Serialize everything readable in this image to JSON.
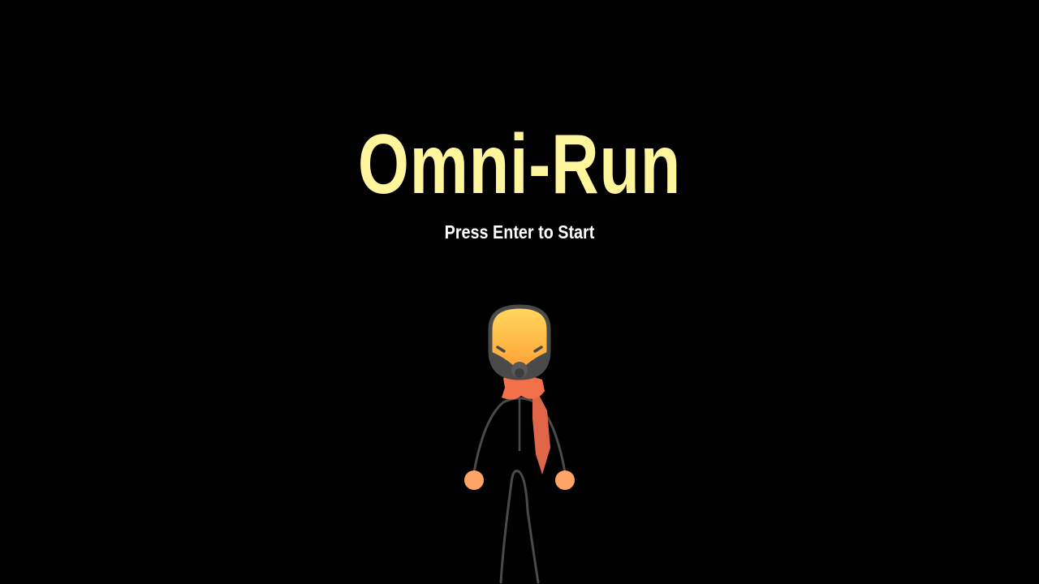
{
  "game": {
    "title": "Omni-Run",
    "prompt": "Press Enter to Start"
  },
  "colors": {
    "background": "#000000",
    "title": "#fff59d",
    "prompt": "#ffffff",
    "body_line": "#4a4a4a",
    "head_top": "#ffd85e",
    "head_bottom": "#ff9a2e",
    "scarf": "#f2704a",
    "hands": "#ffa366"
  },
  "character": {
    "icon": "stick-runner-with-gas-mask-and-scarf"
  }
}
